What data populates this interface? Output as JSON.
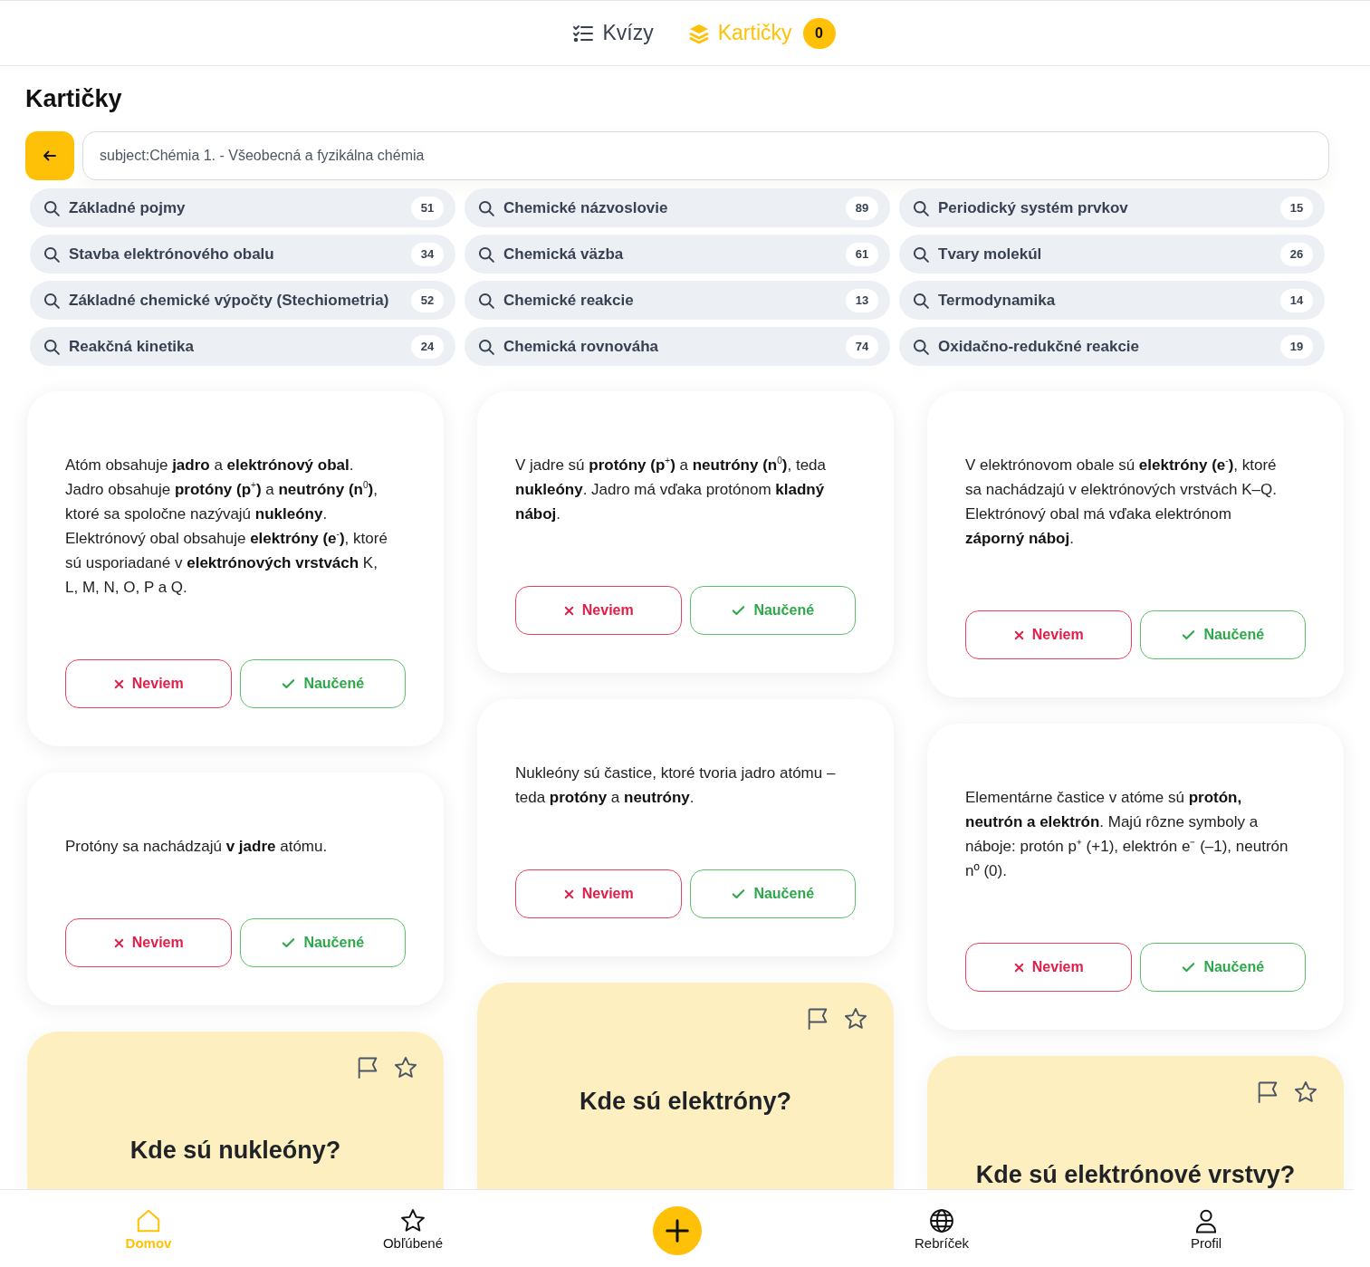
{
  "header": {
    "tabs": [
      {
        "label": "Kvízy",
        "selected": false
      },
      {
        "label": "Kartičky",
        "selected": true,
        "badge": "0"
      }
    ]
  },
  "title": "Kartičky",
  "search": {
    "value": "subject:Chémia 1. - Všeobecná a fyzikálna chémia"
  },
  "topics": [
    {
      "label": "Základné pojmy",
      "count": "51"
    },
    {
      "label": "Chemické názvoslovie",
      "count": "89"
    },
    {
      "label": "Periodický systém prvkov",
      "count": "15"
    },
    {
      "label": "Stavba elektrónového obalu",
      "count": "34"
    },
    {
      "label": "Chemická väzba",
      "count": "61"
    },
    {
      "label": "Tvary molekúl",
      "count": "26"
    },
    {
      "label": "Základné chemické výpočty (Stechiometria)",
      "count": "52"
    },
    {
      "label": "Chemické reakcie",
      "count": "13"
    },
    {
      "label": "Termodynamika",
      "count": "14"
    },
    {
      "label": "Reakčná kinetika",
      "count": "24"
    },
    {
      "label": "Chemická rovnováha",
      "count": "74"
    },
    {
      "label": "Oxidačno-redukčné reakcie",
      "count": "19"
    }
  ],
  "columns": [
    [
      {
        "kind": "answer",
        "text": "Atóm obsahuje **jadro** a **elektrónový obal**. Jadro obsahuje **protóny (p**$^{+}$**)** a **neutróny (n**$^{0}$**)**, ktoré sa spoločne nazývajú **nukleóny**. Elektrónový obal obsahuje **elektróny (e**$^{-}$**)**, ktoré sú usporiadané v **elektrónových vrstvách** K, L, M, N, O, P a Q.",
        "dont_know": "Neviem",
        "learned": "Naučené"
      },
      {
        "kind": "answer",
        "text": "Protóny sa nachádzajú **v jadre** atómu.",
        "dont_know": "Neviem",
        "learned": "Naučené"
      },
      {
        "kind": "question",
        "text": "Kde sú nukleóny?"
      }
    ],
    [
      {
        "kind": "answer",
        "text": "V jadre sú **protóny (p**$^{+}$**)** a **neutróny (n**$^{0}$**)**, teda **nukleóny**. Jadro má vďaka protónom **kladný náboj**.",
        "dont_know": "Neviem",
        "learned": "Naučené"
      },
      {
        "kind": "answer",
        "text": "Nukleóny sú častice, ktoré tvoria jadro atómu – teda **protóny** a **neutróny**.",
        "dont_know": "Neviem",
        "learned": "Naučené"
      },
      {
        "kind": "question",
        "text": "Kde sú elektróny?"
      }
    ],
    [
      {
        "kind": "answer",
        "text": "V elektrónovom obale sú **elektróny (e**$^{-}$**)**, ktoré sa nachádzajú v elektrónových vrstvách K–Q. Elektrónový obal má vďaka elektrónom **záporný náboj**.",
        "dont_know": "Neviem",
        "learned": "Naučené"
      },
      {
        "kind": "answer",
        "text": "Elementárne častice v atóme sú **protón, neutrón a elektrón**. Majú rôzne symboly a náboje: protón p⁺ (+1), elektrón e⁻ (–1), neutrón nº (0).",
        "dont_know": "Neviem",
        "learned": "Naučené"
      },
      {
        "kind": "question",
        "text": "Kde sú elektrónové vrstvy?"
      }
    ]
  ],
  "nav": [
    {
      "kind": "tab",
      "label": "Domov",
      "selected": true
    },
    {
      "kind": "tab",
      "label": "Obľúbené",
      "selected": false
    },
    {
      "kind": "add"
    },
    {
      "kind": "tab",
      "label": "Rebríček",
      "selected": false
    },
    {
      "kind": "tab",
      "label": "Profil",
      "selected": false
    }
  ]
}
